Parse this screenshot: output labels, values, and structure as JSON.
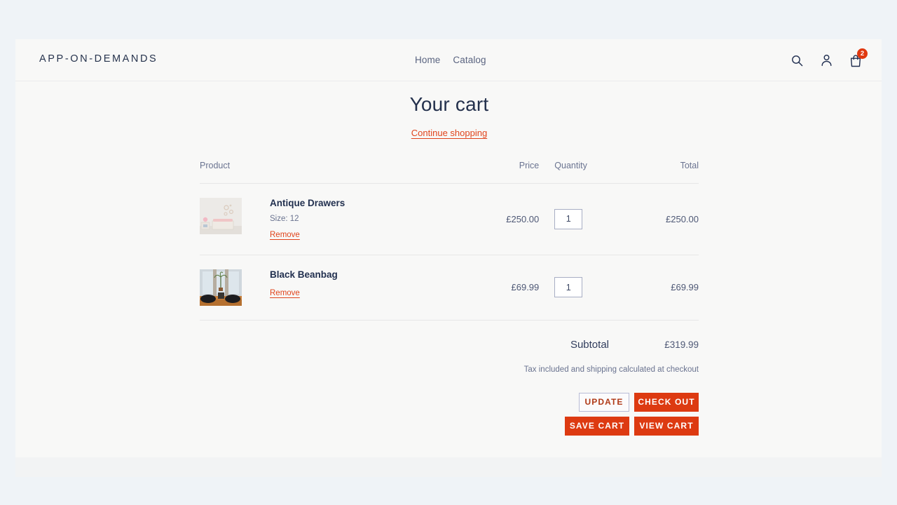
{
  "header": {
    "brand": "APP-ON-DEMANDS",
    "nav": [
      {
        "label": "Home"
      },
      {
        "label": "Catalog"
      }
    ],
    "icons": {
      "search": "search-icon",
      "account": "account-icon",
      "cart": "cart-icon"
    },
    "cart_count": "2"
  },
  "cart": {
    "title": "Your cart",
    "continue_shopping": "Continue shopping",
    "columns": {
      "product": "Product",
      "price": "Price",
      "quantity": "Quantity",
      "total": "Total"
    },
    "items": [
      {
        "title": "Antique Drawers",
        "variant": "Size: 12",
        "remove": "Remove",
        "price": "£250.00",
        "quantity": "1",
        "total": "£250.00",
        "thumb": "nursery-dresser-photo"
      },
      {
        "title": "Black Beanbag",
        "variant": "",
        "remove": "Remove",
        "price": "£69.99",
        "quantity": "1",
        "total": "£69.99",
        "thumb": "beanbag-room-photo"
      }
    ],
    "subtotal_label": "Subtotal",
    "subtotal_value": "£319.99",
    "tax_note": "Tax included and shipping calculated at checkout",
    "buttons": {
      "update": "UPDATE",
      "checkout": "CHECK OUT",
      "save_cart": "SAVE CART",
      "view_cart": "VIEW CART"
    }
  },
  "colors": {
    "accent": "#dd3a11",
    "link": "#e0441c",
    "heading": "#24314d",
    "muted": "#6a7390",
    "page_bg": "#eff3f7",
    "content_bg": "#f8f8f7"
  }
}
